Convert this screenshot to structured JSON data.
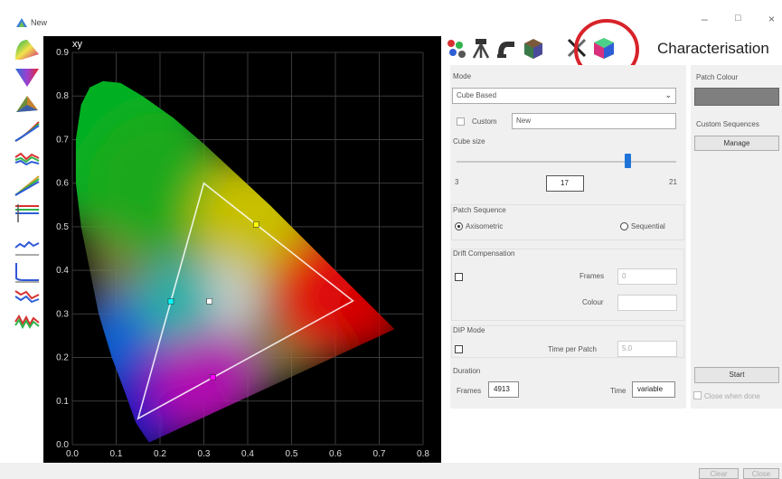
{
  "window": {
    "title": "New",
    "minimize": "–",
    "maximize": "□",
    "close": "×"
  },
  "chart_data": {
    "type": "scatter",
    "title": "xy",
    "xlabel": "",
    "ylabel": "",
    "xlim": [
      0.0,
      0.8
    ],
    "ylim": [
      0.0,
      0.9
    ],
    "grid": true,
    "x_ticks": [
      "0.0",
      "0.1",
      "0.2",
      "0.3",
      "0.4",
      "0.5",
      "0.6",
      "0.7",
      "0.8"
    ],
    "y_ticks": [
      "0.0",
      "0.1",
      "0.2",
      "0.3",
      "0.4",
      "0.5",
      "0.6",
      "0.7",
      "0.8",
      "0.9"
    ],
    "gamut_triangle": [
      [
        0.64,
        0.33
      ],
      [
        0.3,
        0.6
      ],
      [
        0.15,
        0.06
      ]
    ],
    "points": [
      {
        "x": 0.4193,
        "y": 0.5053,
        "color": "#ffff00"
      },
      {
        "x": 0.2247,
        "y": 0.3287,
        "color": "#00ffff"
      },
      {
        "x": 0.3209,
        "y": 0.1542,
        "color": "#ff00ff"
      },
      {
        "x": 0.3127,
        "y": 0.329,
        "color": "#ffffff"
      }
    ]
  },
  "toolbar": {
    "tools": [
      "cie-diagram",
      "triangle",
      "3d-gamut",
      "gamma-curve",
      "rgb-balance",
      "luminance-curve",
      "levels",
      "deviation",
      "deviation-2",
      "deviation-3",
      "deviation-4"
    ]
  },
  "panel": {
    "heading": "Characterisation",
    "mode": {
      "label": "Mode",
      "value": "Cube Based"
    },
    "custom": {
      "label": "Custom",
      "value": "New"
    },
    "cube_size": {
      "label": "Cube size",
      "min": "3",
      "max": "21",
      "value": "17",
      "level": 17
    },
    "patch_sequence": {
      "label": "Patch Sequence",
      "option_a": "Axisometric",
      "option_b": "Sequential"
    },
    "drift": {
      "label": "Drift Compensation",
      "frames_label": "Frames",
      "frames_value": "0",
      "colour_label": "Colour"
    },
    "dip": {
      "label": "DIP Mode",
      "time_label": "Time per Patch",
      "time_value": "5.0"
    },
    "duration": {
      "label": "Duration",
      "frames_label": "Frames",
      "frames_value": "4913",
      "time_label": "Time",
      "time_value": "variable"
    },
    "patch_colour_label": "Patch Colour",
    "patch_colour": "#7f7f7f",
    "custom_sequences_label": "Custom Sequences",
    "manage_label": "Manage",
    "start_label": "Start",
    "close_when_done_label": "Close when done"
  },
  "footer": {
    "clear": "Clear",
    "close": "Close"
  },
  "colors": {
    "highlight_circle": "#d8232a",
    "plot_bg": "#000000"
  }
}
